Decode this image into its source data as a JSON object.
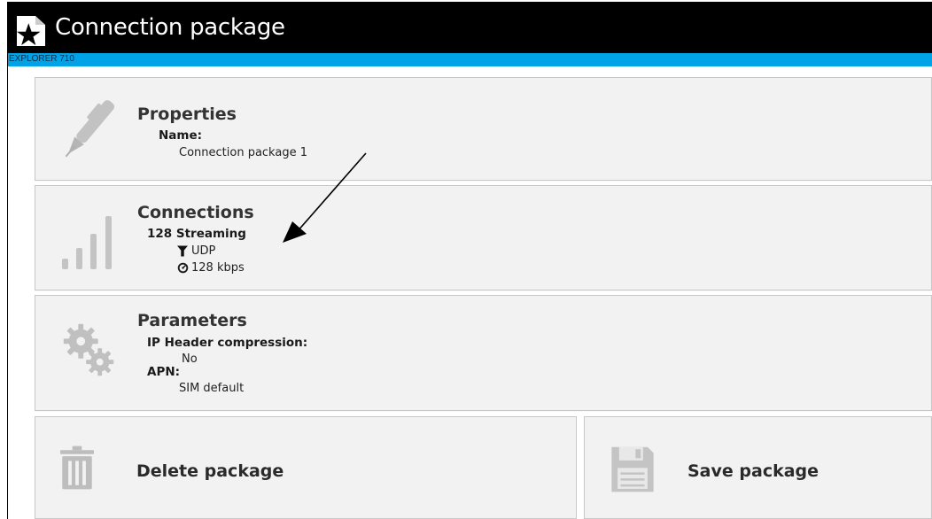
{
  "header": {
    "title": "Connection package",
    "device": "EXPLORER 710"
  },
  "properties": {
    "heading": "Properties",
    "name_label": "Name:",
    "name_value": "Connection package 1"
  },
  "connections": {
    "heading": "Connections",
    "item_name": "128 Streaming",
    "protocol": "UDP",
    "bandwidth": "128 kbps"
  },
  "parameters": {
    "heading": "Parameters",
    "ip_header_label": "IP Header compression:",
    "ip_header_value": "No",
    "apn_label": "APN:",
    "apn_value": "SIM default"
  },
  "actions": {
    "delete_label": "Delete package",
    "save_label": "Save package"
  },
  "icons": {
    "title": "package-star-icon",
    "properties": "pen-icon",
    "connections": "signal-bars-icon",
    "parameters": "gears-icon",
    "protocol": "filter-icon",
    "bandwidth": "gauge-icon",
    "delete": "trash-icon",
    "save": "floppy-disk-icon"
  },
  "colors": {
    "titlebar": "#000000",
    "devicebar": "#00a3e8",
    "panel": "#f2f2f2",
    "icon_gray": "#b8b8b8"
  }
}
